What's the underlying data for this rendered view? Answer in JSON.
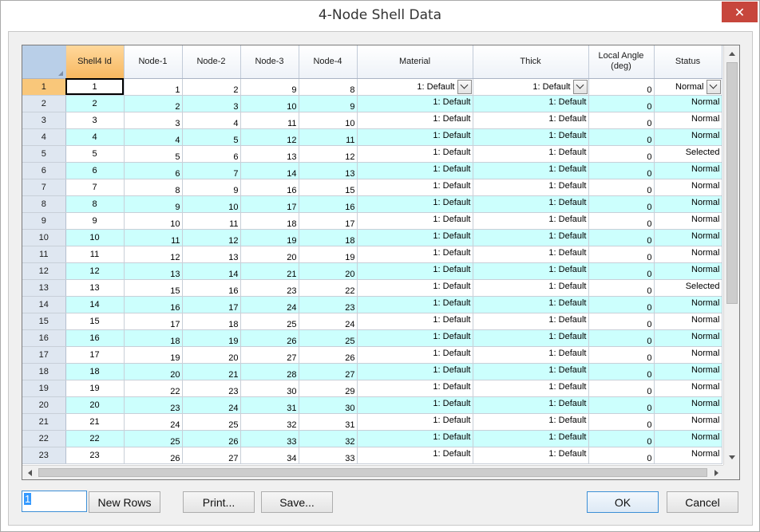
{
  "window": {
    "title": "4-Node Shell Data",
    "close_glyph": "✕"
  },
  "grid": {
    "columns": [
      {
        "label": "",
        "width": 54
      },
      {
        "label": "Shell4 Id",
        "width": 73
      },
      {
        "label": "Node-1",
        "width": 73
      },
      {
        "label": "Node-2",
        "width": 73
      },
      {
        "label": "Node-3",
        "width": 73
      },
      {
        "label": "Node-4",
        "width": 73
      },
      {
        "label": "Material",
        "width": 145
      },
      {
        "label": "Thick",
        "width": 145
      },
      {
        "label": "Local Angle\n(deg)",
        "width": 82
      },
      {
        "label": "Status",
        "width": 85
      }
    ],
    "rows": [
      {
        "row": "1",
        "id": "1",
        "n1": "1",
        "n2": "2",
        "n3": "9",
        "n4": "8",
        "material": "1: Default",
        "thick": "1: Default",
        "angle": "0",
        "status": "Normal"
      },
      {
        "row": "2",
        "id": "2",
        "n1": "2",
        "n2": "3",
        "n3": "10",
        "n4": "9",
        "material": "1: Default",
        "thick": "1: Default",
        "angle": "0",
        "status": "Normal"
      },
      {
        "row": "3",
        "id": "3",
        "n1": "3",
        "n2": "4",
        "n3": "11",
        "n4": "10",
        "material": "1: Default",
        "thick": "1: Default",
        "angle": "0",
        "status": "Normal"
      },
      {
        "row": "4",
        "id": "4",
        "n1": "4",
        "n2": "5",
        "n3": "12",
        "n4": "11",
        "material": "1: Default",
        "thick": "1: Default",
        "angle": "0",
        "status": "Normal"
      },
      {
        "row": "5",
        "id": "5",
        "n1": "5",
        "n2": "6",
        "n3": "13",
        "n4": "12",
        "material": "1: Default",
        "thick": "1: Default",
        "angle": "0",
        "status": "Selected"
      },
      {
        "row": "6",
        "id": "6",
        "n1": "6",
        "n2": "7",
        "n3": "14",
        "n4": "13",
        "material": "1: Default",
        "thick": "1: Default",
        "angle": "0",
        "status": "Normal"
      },
      {
        "row": "7",
        "id": "7",
        "n1": "8",
        "n2": "9",
        "n3": "16",
        "n4": "15",
        "material": "1: Default",
        "thick": "1: Default",
        "angle": "0",
        "status": "Normal"
      },
      {
        "row": "8",
        "id": "8",
        "n1": "9",
        "n2": "10",
        "n3": "17",
        "n4": "16",
        "material": "1: Default",
        "thick": "1: Default",
        "angle": "0",
        "status": "Normal"
      },
      {
        "row": "9",
        "id": "9",
        "n1": "10",
        "n2": "11",
        "n3": "18",
        "n4": "17",
        "material": "1: Default",
        "thick": "1: Default",
        "angle": "0",
        "status": "Normal"
      },
      {
        "row": "10",
        "id": "10",
        "n1": "11",
        "n2": "12",
        "n3": "19",
        "n4": "18",
        "material": "1: Default",
        "thick": "1: Default",
        "angle": "0",
        "status": "Normal"
      },
      {
        "row": "11",
        "id": "11",
        "n1": "12",
        "n2": "13",
        "n3": "20",
        "n4": "19",
        "material": "1: Default",
        "thick": "1: Default",
        "angle": "0",
        "status": "Normal"
      },
      {
        "row": "12",
        "id": "12",
        "n1": "13",
        "n2": "14",
        "n3": "21",
        "n4": "20",
        "material": "1: Default",
        "thick": "1: Default",
        "angle": "0",
        "status": "Normal"
      },
      {
        "row": "13",
        "id": "13",
        "n1": "15",
        "n2": "16",
        "n3": "23",
        "n4": "22",
        "material": "1: Default",
        "thick": "1: Default",
        "angle": "0",
        "status": "Selected"
      },
      {
        "row": "14",
        "id": "14",
        "n1": "16",
        "n2": "17",
        "n3": "24",
        "n4": "23",
        "material": "1: Default",
        "thick": "1: Default",
        "angle": "0",
        "status": "Normal"
      },
      {
        "row": "15",
        "id": "15",
        "n1": "17",
        "n2": "18",
        "n3": "25",
        "n4": "24",
        "material": "1: Default",
        "thick": "1: Default",
        "angle": "0",
        "status": "Normal"
      },
      {
        "row": "16",
        "id": "16",
        "n1": "18",
        "n2": "19",
        "n3": "26",
        "n4": "25",
        "material": "1: Default",
        "thick": "1: Default",
        "angle": "0",
        "status": "Normal"
      },
      {
        "row": "17",
        "id": "17",
        "n1": "19",
        "n2": "20",
        "n3": "27",
        "n4": "26",
        "material": "1: Default",
        "thick": "1: Default",
        "angle": "0",
        "status": "Normal"
      },
      {
        "row": "18",
        "id": "18",
        "n1": "20",
        "n2": "21",
        "n3": "28",
        "n4": "27",
        "material": "1: Default",
        "thick": "1: Default",
        "angle": "0",
        "status": "Normal"
      },
      {
        "row": "19",
        "id": "19",
        "n1": "22",
        "n2": "23",
        "n3": "30",
        "n4": "29",
        "material": "1: Default",
        "thick": "1: Default",
        "angle": "0",
        "status": "Normal"
      },
      {
        "row": "20",
        "id": "20",
        "n1": "23",
        "n2": "24",
        "n3": "31",
        "n4": "30",
        "material": "1: Default",
        "thick": "1: Default",
        "angle": "0",
        "status": "Normal"
      },
      {
        "row": "21",
        "id": "21",
        "n1": "24",
        "n2": "25",
        "n3": "32",
        "n4": "31",
        "material": "1: Default",
        "thick": "1: Default",
        "angle": "0",
        "status": "Normal"
      },
      {
        "row": "22",
        "id": "22",
        "n1": "25",
        "n2": "26",
        "n3": "33",
        "n4": "32",
        "material": "1: Default",
        "thick": "1: Default",
        "angle": "0",
        "status": "Normal"
      },
      {
        "row": "23",
        "id": "23",
        "n1": "26",
        "n2": "27",
        "n3": "34",
        "n4": "33",
        "material": "1: Default",
        "thick": "1: Default",
        "angle": "0",
        "status": "Normal"
      }
    ]
  },
  "footer": {
    "rows_input_value": "1",
    "new_rows_label": "New Rows",
    "print_label": "Print...",
    "save_label": "Save...",
    "ok_label": "OK",
    "cancel_label": "Cancel"
  },
  "colors": {
    "alt_row": "#ccfffd",
    "selected_header": "#f7b860",
    "close_button": "#c7463c"
  }
}
